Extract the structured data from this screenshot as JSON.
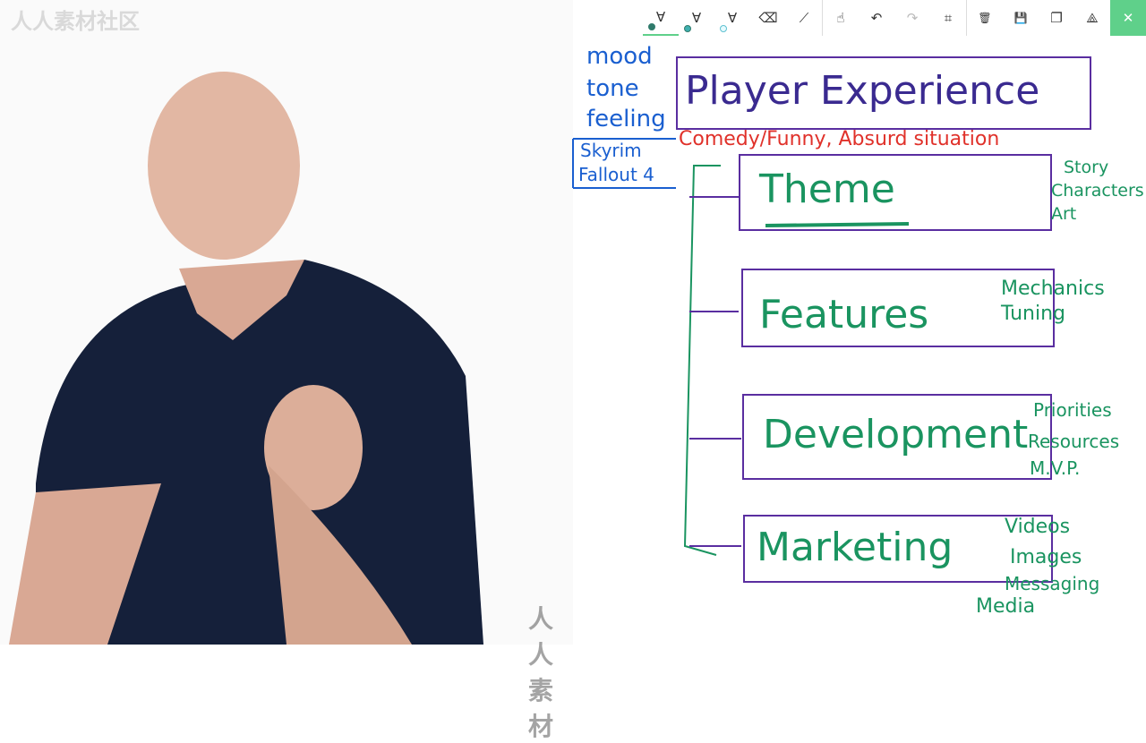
{
  "toolbar": {
    "tools": [
      {
        "icon": "ballpoint-pen-icon",
        "color": "#2f7a6b",
        "selected": true
      },
      {
        "icon": "pencil-icon",
        "color": "#3fb0b0"
      },
      {
        "icon": "highlighter-icon",
        "color": "#5fc0d0"
      },
      {
        "icon": "eraser-icon"
      },
      {
        "icon": "ruler-icon"
      },
      {
        "icon": "touch-writing-icon"
      },
      {
        "icon": "undo-icon"
      },
      {
        "icon": "redo-icon"
      },
      {
        "icon": "crop-icon"
      },
      {
        "icon": "delete-icon"
      },
      {
        "icon": "save-icon"
      },
      {
        "icon": "copy-icon"
      },
      {
        "icon": "share-icon"
      },
      {
        "icon": "close-icon"
      }
    ],
    "glyphs": {
      "pen": "∀",
      "undo": "↶",
      "redo": "↷",
      "crop": "⌗",
      "delete": "🗑",
      "save": "💾",
      "copy": "❐",
      "share": "⟁",
      "close": "✕",
      "eraser": "⌫",
      "ruler": "⟋",
      "touch": "☝"
    }
  },
  "watermark": {
    "top": "人人素材社区",
    "bottom": "人人素材"
  },
  "whiteboard": {
    "title": "Player Experience",
    "mood_notes": [
      "mood",
      "tone",
      "feeling"
    ],
    "examples": [
      "Skyrim",
      "Fallout 4"
    ],
    "subtitle": "Comedy/Funny, Absurd situation",
    "sections": [
      {
        "label": "Theme",
        "notes": [
          "Story",
          "Characters",
          "Art"
        ]
      },
      {
        "label": "Features",
        "notes": [
          "Mechanics",
          "Tuning"
        ]
      },
      {
        "label": "Development",
        "notes": [
          "Priorities",
          "Resources",
          "M.V.P."
        ]
      },
      {
        "label": "Marketing",
        "notes": [
          "Videos",
          "Images",
          "Messaging",
          "Media"
        ]
      }
    ]
  },
  "colors": {
    "box": "#5a2ea0",
    "green": "#1a9460",
    "blue": "#1a5fd0",
    "red": "#e0312a",
    "accent_close": "#5fd08a"
  }
}
